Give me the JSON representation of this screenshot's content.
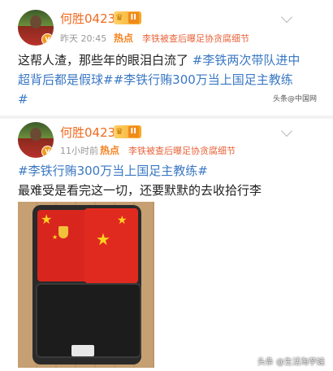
{
  "posts": [
    {
      "username": "何胜0423",
      "vip_level": "II",
      "time": "昨天 20:45",
      "hot_label": "热点",
      "hot_topic": "李铁被查后曝足协贪腐细节",
      "text_before_tags": "这帮人渣，那些年的眼泪白流了",
      "tag1": "#李铁两次带队进中超背后都是假球#",
      "tag2": "#李铁行贿300万当上国足主教练#",
      "source": "头条@中国网"
    },
    {
      "username": "何胜0423",
      "vip_level": "II",
      "time": "11小时前",
      "hot_label": "热点",
      "hot_topic": "李铁被查后曝足协贪腐细节",
      "tag": "#李铁行贿300万当上国足主教练#",
      "text": "最难受是看完这一切，还要默默的去收拾行李",
      "watermark": "头条 @生活淘芋娃"
    }
  ],
  "colors": {
    "username": "#f06a1e",
    "hashtag": "#3a78c4",
    "hot": "#f5821f"
  },
  "icons": {
    "vip": "crown-badge-icon",
    "verified": "verified-v-icon",
    "more": "chevron-down-icon"
  }
}
